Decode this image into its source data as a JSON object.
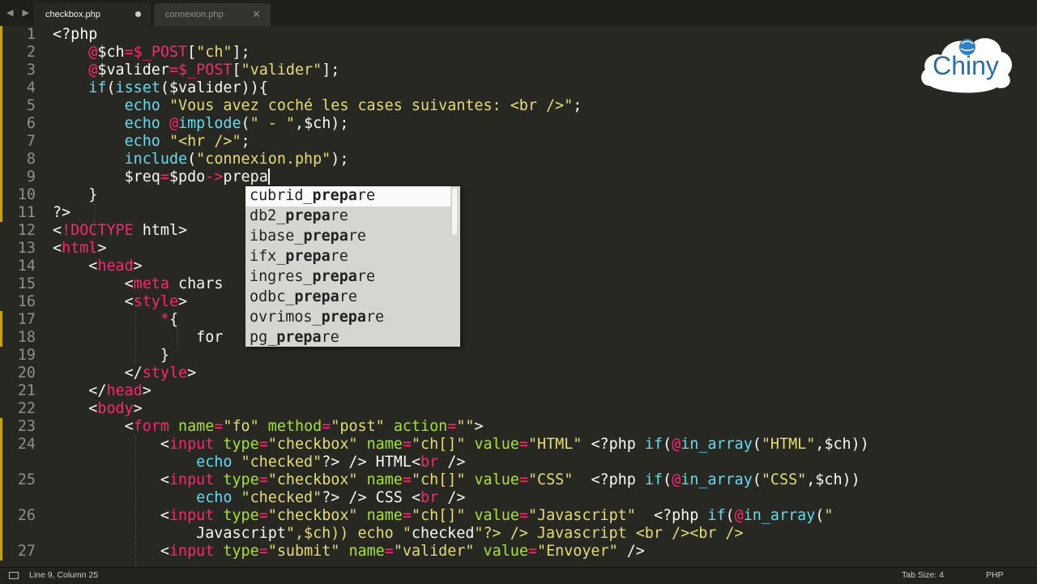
{
  "tabs": [
    {
      "label": "checkbox.php",
      "active": true,
      "modified": true
    },
    {
      "label": "connexion.php",
      "active": false,
      "modified": false
    }
  ],
  "nav_arrows": "◀ ▶",
  "close_glyph": "✕",
  "editor": {
    "lines": [
      {
        "num": "1",
        "text": "<?php"
      },
      {
        "num": "2",
        "text": "    @$ch=$_POST[\"ch\"];"
      },
      {
        "num": "3",
        "text": "    @$valider=$_POST[\"valider\"];"
      },
      {
        "num": "4",
        "text": "    if(isset($valider)){"
      },
      {
        "num": "5",
        "text": "        echo \"Vous avez coché les cases suivantes: <br />\";"
      },
      {
        "num": "6",
        "text": "        echo @implode(\" - \",$ch);"
      },
      {
        "num": "7",
        "text": "        echo \"<hr />\";"
      },
      {
        "num": "8",
        "text": "        include(\"connexion.php\");"
      },
      {
        "num": "9",
        "text": "        $req=$pdo->prepa"
      },
      {
        "num": "10",
        "text": "    }"
      },
      {
        "num": "11",
        "text": "?>"
      },
      {
        "num": "12",
        "text": "<!DOCTYPE html>"
      },
      {
        "num": "13",
        "text": "<html>"
      },
      {
        "num": "14",
        "text": "    <head>"
      },
      {
        "num": "15",
        "text": "        <meta chars"
      },
      {
        "num": "16",
        "text": "        <style>"
      },
      {
        "num": "17",
        "text": "            *{"
      },
      {
        "num": "18",
        "text": "                for"
      },
      {
        "num": "19",
        "text": "            }"
      },
      {
        "num": "20",
        "text": "        </style>"
      },
      {
        "num": "21",
        "text": "    </head>"
      },
      {
        "num": "22",
        "text": "    <body>"
      },
      {
        "num": "23",
        "text": "        <form name=\"fo\" method=\"post\" action=\"\">"
      },
      {
        "num": "24",
        "text": "            <input type=\"checkbox\" name=\"ch[]\" value=\"HTML\" <?php if(@in_array(\"HTML\",$ch))"
      },
      {
        "num": "",
        "text": "                echo \"checked\"?> /> HTML<br />"
      },
      {
        "num": "25",
        "text": "            <input type=\"checkbox\" name=\"ch[]\" value=\"CSS\"  <?php if(@in_array(\"CSS\",$ch))"
      },
      {
        "num": "",
        "text": "                echo \"checked\"?> /> CSS <br />"
      },
      {
        "num": "26",
        "text": "            <input type=\"checkbox\" name=\"ch[]\" value=\"Javascript\"  <?php if(@in_array(\""
      },
      {
        "num": "",
        "text": "                Javascript\",$ch)) echo \"checked\"?> /> Javascript <br /><br />"
      },
      {
        "num": "27",
        "text": "            <input type=\"submit\" name=\"valider\" value=\"Envoyer\" />"
      }
    ]
  },
  "autocomplete": {
    "typed": "prepa",
    "items": [
      {
        "prefix": "cubrid_",
        "match": "prepa",
        "suffix": "re"
      },
      {
        "prefix": "db2_",
        "match": "prepa",
        "suffix": "re"
      },
      {
        "prefix": "ibase_",
        "match": "prepa",
        "suffix": "re"
      },
      {
        "prefix": "ifx_",
        "match": "prepa",
        "suffix": "re"
      },
      {
        "prefix": "ingres_",
        "match": "prepa",
        "suffix": "re"
      },
      {
        "prefix": "odbc_",
        "match": "prepa",
        "suffix": "re"
      },
      {
        "prefix": "ovrimos_",
        "match": "prepa",
        "suffix": "re"
      },
      {
        "prefix": "pg_",
        "match": "prepa",
        "suffix": "re"
      }
    ],
    "selected_index": 0
  },
  "logo": {
    "text": "Chiny"
  },
  "status_bar": {
    "position": "Line 9, Column 25",
    "tab_size": "Tab Size: 4",
    "syntax": "PHP"
  },
  "colors": {
    "editor_bg": "#272822",
    "keyword": "#f92672",
    "string": "#e6db74",
    "function": "#66d9ef",
    "attribute": "#a6e22e"
  }
}
